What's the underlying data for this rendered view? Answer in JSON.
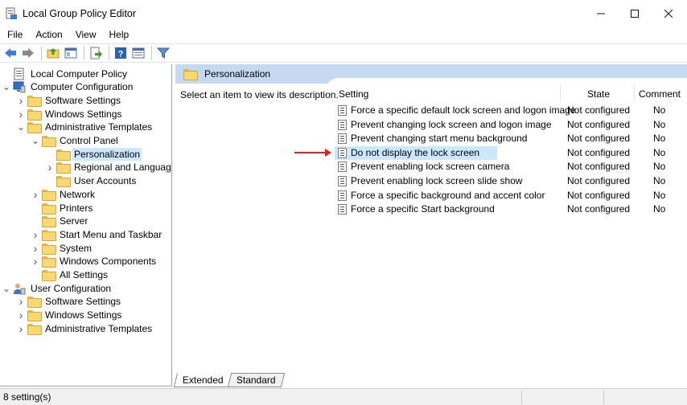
{
  "window": {
    "title": "Local Group Policy Editor",
    "minimize": "—",
    "maximize": "☐",
    "close": "✕"
  },
  "menu": [
    "File",
    "Action",
    "View",
    "Help"
  ],
  "tree": [
    {
      "label": "Local Computer Policy",
      "depth": 0,
      "arrow": "",
      "icon": "policy"
    },
    {
      "label": "Computer Configuration",
      "depth": 0,
      "arrow": "down",
      "icon": "computer"
    },
    {
      "label": "Software Settings",
      "depth": 1,
      "arrow": "right",
      "icon": "folder"
    },
    {
      "label": "Windows Settings",
      "depth": 1,
      "arrow": "right",
      "icon": "folder"
    },
    {
      "label": "Administrative Templates",
      "depth": 1,
      "arrow": "down",
      "icon": "folder"
    },
    {
      "label": "Control Panel",
      "depth": 2,
      "arrow": "down",
      "icon": "folder"
    },
    {
      "label": "Personalization",
      "depth": 3,
      "arrow": "",
      "icon": "folder",
      "selected": true
    },
    {
      "label": "Regional and Language",
      "depth": 3,
      "arrow": "right",
      "icon": "folder"
    },
    {
      "label": "User Accounts",
      "depth": 3,
      "arrow": "",
      "icon": "folder"
    },
    {
      "label": "Network",
      "depth": 2,
      "arrow": "right",
      "icon": "folder"
    },
    {
      "label": "Printers",
      "depth": 2,
      "arrow": "",
      "icon": "folder"
    },
    {
      "label": "Server",
      "depth": 2,
      "arrow": "",
      "icon": "folder"
    },
    {
      "label": "Start Menu and Taskbar",
      "depth": 2,
      "arrow": "right",
      "icon": "folder"
    },
    {
      "label": "System",
      "depth": 2,
      "arrow": "right",
      "icon": "folder"
    },
    {
      "label": "Windows Components",
      "depth": 2,
      "arrow": "right",
      "icon": "folder"
    },
    {
      "label": "All Settings",
      "depth": 2,
      "arrow": "",
      "icon": "folder"
    },
    {
      "label": "User Configuration",
      "depth": 0,
      "arrow": "down",
      "icon": "user"
    },
    {
      "label": "Software Settings",
      "depth": 1,
      "arrow": "right",
      "icon": "folder"
    },
    {
      "label": "Windows Settings",
      "depth": 1,
      "arrow": "right",
      "icon": "folder"
    },
    {
      "label": "Administrative Templates",
      "depth": 1,
      "arrow": "right",
      "icon": "folder"
    }
  ],
  "right": {
    "header_title": "Personalization",
    "description": "Select an item to view its description.",
    "columns": {
      "setting": "Setting",
      "state": "State",
      "comment": "Comment"
    },
    "rows": [
      {
        "setting": "Force a specific default lock screen and logon image",
        "state": "Not configured",
        "comment": "No"
      },
      {
        "setting": "Prevent changing lock screen and logon image",
        "state": "Not configured",
        "comment": "No"
      },
      {
        "setting": "Prevent changing start menu background",
        "state": "Not configured",
        "comment": "No"
      },
      {
        "setting": "Do not display the lock screen",
        "state": "Not configured",
        "comment": "No",
        "highlight": true
      },
      {
        "setting": "Prevent enabling lock screen camera",
        "state": "Not configured",
        "comment": "No"
      },
      {
        "setting": "Prevent enabling lock screen slide show",
        "state": "Not configured",
        "comment": "No"
      },
      {
        "setting": "Force a specific background and accent color",
        "state": "Not configured",
        "comment": "No"
      },
      {
        "setting": "Force a specific Start background",
        "state": "Not configured",
        "comment": "No"
      }
    ]
  },
  "tabs": [
    {
      "label": "Extended",
      "active": true
    },
    {
      "label": "Standard",
      "active": false
    }
  ],
  "status": {
    "text": "8 setting(s)"
  },
  "colors": {
    "header_band": "#c5d9f1",
    "selection": "#cce8ff",
    "annotation_arrow": "#e0201c"
  }
}
